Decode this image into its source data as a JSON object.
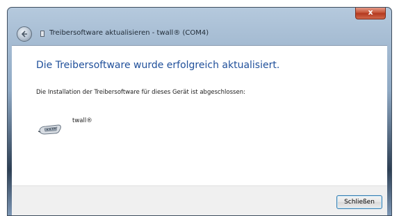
{
  "window": {
    "title": "Treibersoftware aktualisieren - twall® (COM4)",
    "close_glyph": "x"
  },
  "icons": {
    "back": "back-arrow-icon",
    "app": "window-app-icon",
    "close": "close-icon",
    "device": "serial-port-device-icon"
  },
  "content": {
    "heading": "Die Treibersoftware wurde erfolgreich aktualisiert.",
    "description": "Die Installation der Treibersoftware für dieses Gerät ist abgeschlossen:",
    "device_name": "twall®"
  },
  "footer": {
    "close_label": "Schließen"
  },
  "colors": {
    "heading": "#1f4f9a",
    "close_button_red": "#c95b3f"
  }
}
